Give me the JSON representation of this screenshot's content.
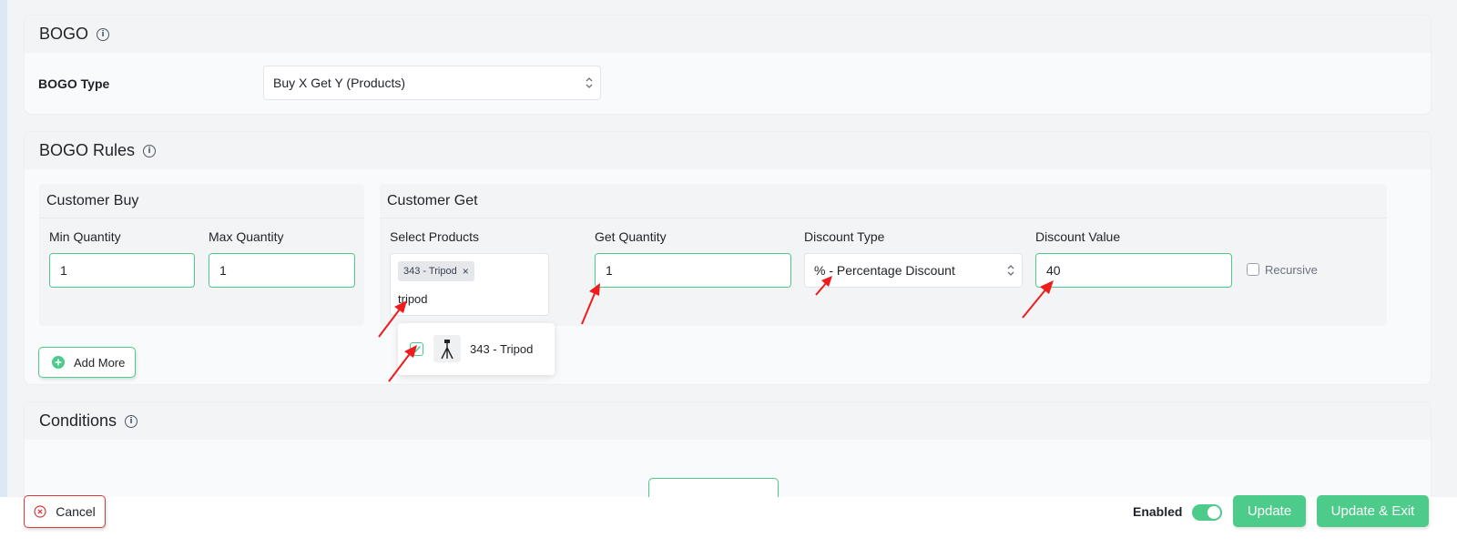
{
  "bogo_section": {
    "title": "BOGO",
    "type_label": "BOGO Type",
    "type_value": "Buy X Get Y (Products)"
  },
  "rules_section": {
    "title": "BOGO Rules",
    "customer_buy": {
      "title": "Customer Buy",
      "min_label": "Min Quantity",
      "min_value": "1",
      "max_label": "Max Quantity",
      "max_value": "1"
    },
    "customer_get": {
      "title": "Customer Get",
      "products_label": "Select Products",
      "selected_tag": "343 - Tripod",
      "tag_remove": "×",
      "search_text": "tripod",
      "quantity_label": "Get Quantity",
      "quantity_value": "1",
      "discount_type_label": "Discount Type",
      "discount_type_value": "% - Percentage Discount",
      "discount_value_label": "Discount Value",
      "discount_value": "40",
      "recursive_label": "Recursive"
    },
    "dropdown": {
      "option_label": "343 - Tripod",
      "checked": true
    },
    "add_more_label": "Add More"
  },
  "conditions_section": {
    "title": "Conditions"
  },
  "footer": {
    "cancel_label": "Cancel",
    "enabled_label": "Enabled",
    "enabled_on": true,
    "update_label": "Update",
    "update_exit_label": "Update & Exit"
  },
  "colors": {
    "accent": "#4ccb8a",
    "danger": "#d83a3a",
    "annotation": "#ee1c1c"
  }
}
